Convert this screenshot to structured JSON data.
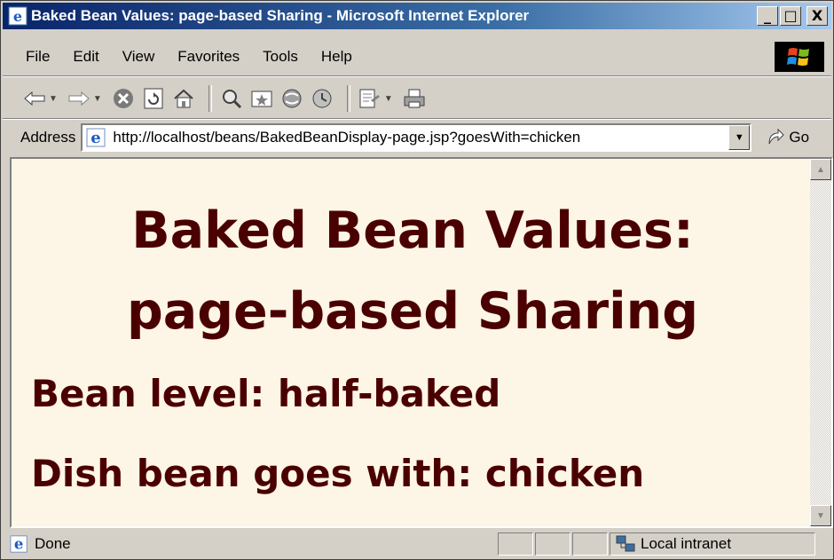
{
  "window": {
    "title": "Baked Bean Values: page-based Sharing - Microsoft Internet Explorer",
    "buttons": [
      "_",
      "□",
      "X"
    ]
  },
  "menu": {
    "items": [
      "File",
      "Edit",
      "View",
      "Favorites",
      "Tools",
      "Help"
    ]
  },
  "toolbar": {
    "icons": [
      "back-icon",
      "forward-icon",
      "stop-icon",
      "refresh-icon",
      "home-icon",
      "search-icon",
      "favorites-icon",
      "media-icon",
      "history-icon",
      "mail-icon",
      "print-icon"
    ]
  },
  "address": {
    "label": "Address",
    "url": "http://localhost/beans/BakedBeanDisplay-page.jsp?goesWith=chicken",
    "go_label": "Go"
  },
  "page": {
    "title_line1": "Baked Bean Values:",
    "title_line2": "page-based Sharing",
    "bean_level": "Bean level: half-baked",
    "goes_with": "Dish bean goes with: chicken",
    "text_color": "#4a0000",
    "background": "#fdf5e6"
  },
  "status": {
    "text": "Done",
    "zone": "Local intranet"
  }
}
